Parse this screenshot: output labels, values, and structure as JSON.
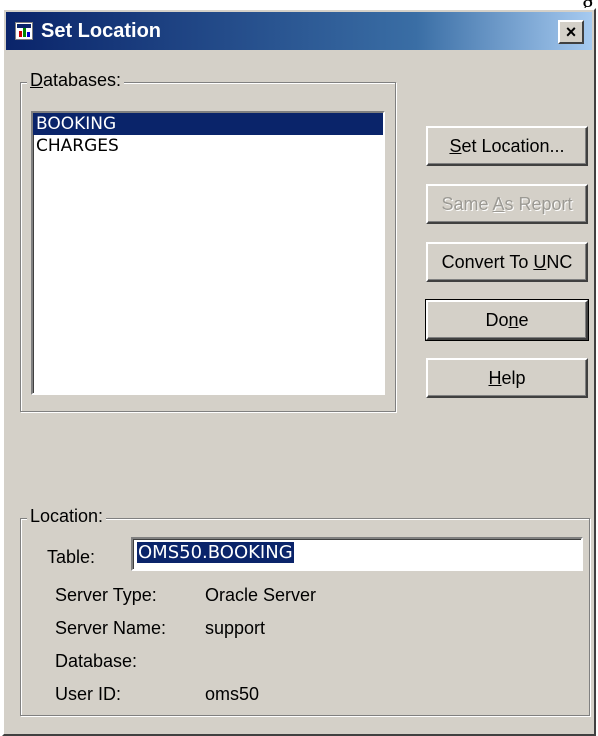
{
  "window": {
    "title": "Set Location",
    "close_label": "×"
  },
  "background_text": "g",
  "databases": {
    "label": "Databases:",
    "items": [
      "BOOKING",
      "CHARGES"
    ],
    "selected_index": 0
  },
  "buttons": {
    "set_location": "Set Location...",
    "same_as_report": "Same As Report",
    "convert_to_unc": "Convert To UNC",
    "done": "Done",
    "help": "Help"
  },
  "location": {
    "label": "Location:",
    "table_label": "Table:",
    "table_value": "OMS50.BOOKING",
    "fields": [
      {
        "label": "Server Type:",
        "value": "Oracle Server"
      },
      {
        "label": "Server Name:",
        "value": "support"
      },
      {
        "label": "Database:",
        "value": ""
      },
      {
        "label": "User ID:",
        "value": "oms50"
      }
    ]
  },
  "colors": {
    "title_bar": "#0a246a",
    "dialog_face": "#d4d0c8",
    "selection": "#0a246a"
  }
}
